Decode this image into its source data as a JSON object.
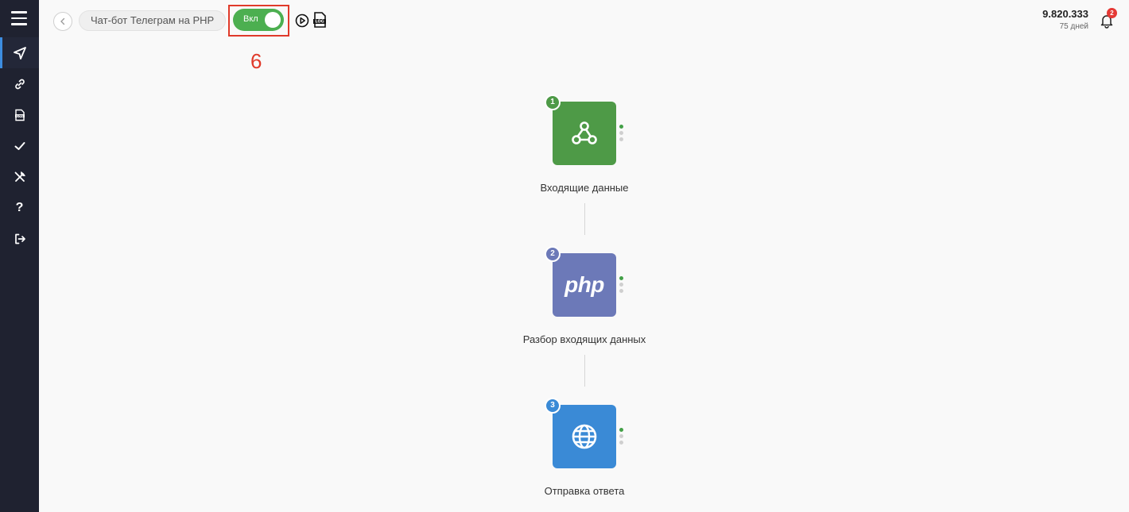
{
  "header": {
    "scenario_title": "Чат-бот Телеграм на PHP",
    "toggle_label": "Вкл",
    "annotation_number": "6",
    "balance_amount": "9.820.333",
    "balance_days": "75 дней",
    "notifications_count": "2"
  },
  "sidebar": {
    "items": [
      {
        "name": "menu",
        "icon": "hamburger-icon"
      },
      {
        "name": "scenarios",
        "icon": "send-icon",
        "active": true
      },
      {
        "name": "connections",
        "icon": "link-icon"
      },
      {
        "name": "logs",
        "icon": "log-file-icon"
      },
      {
        "name": "tasks",
        "icon": "check-icon"
      },
      {
        "name": "tools",
        "icon": "tools-icon"
      },
      {
        "name": "help",
        "icon": "question-icon",
        "glyph": "?"
      },
      {
        "name": "logout",
        "icon": "logout-icon"
      }
    ]
  },
  "flow": {
    "nodes": [
      {
        "number": "1",
        "label": "Входящие данные",
        "color": "#4e9a47",
        "icon": "webhook-icon"
      },
      {
        "number": "2",
        "label": "Разбор входящих данных",
        "color": "#6c79b8",
        "icon": "php-logo",
        "logo_text": "php"
      },
      {
        "number": "3",
        "label": "Отправка ответа",
        "color": "#3a8ad6",
        "icon": "globe-icon"
      }
    ]
  },
  "colors": {
    "sidebar_bg": "#1f2230",
    "accent": "#3d8de0",
    "toggle_on": "#4caf50",
    "annotation": "#e03a2a"
  }
}
